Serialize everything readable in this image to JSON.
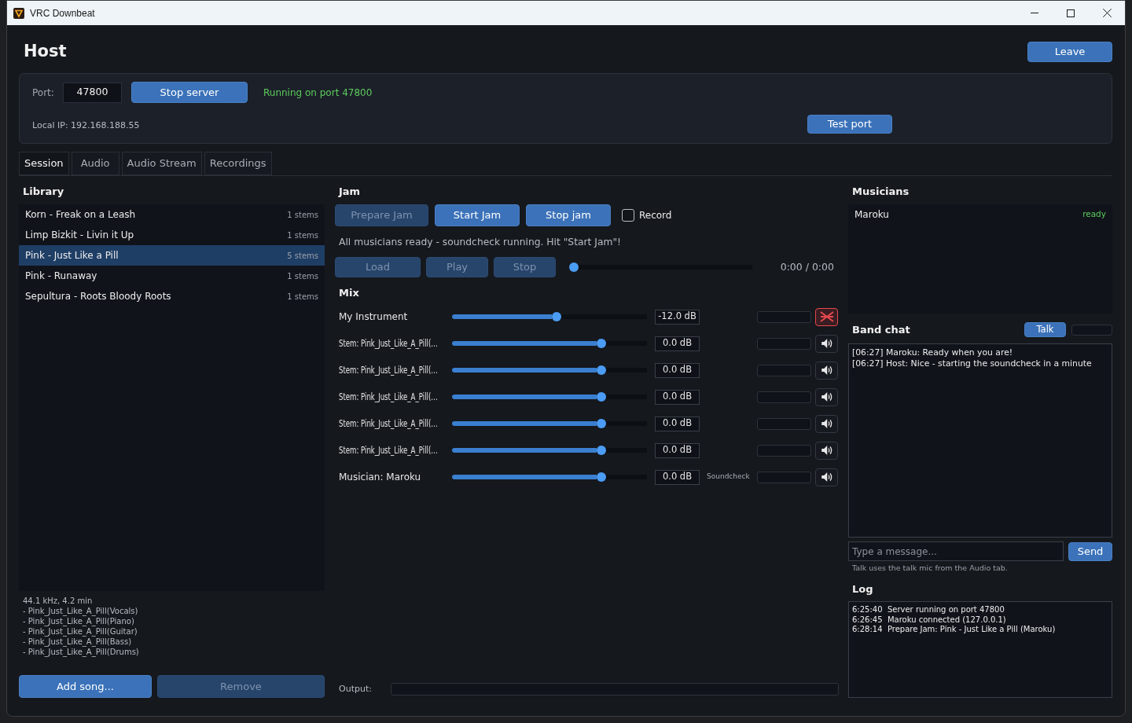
{
  "window": {
    "title": "VRC Downbeat"
  },
  "header": {
    "title": "Host",
    "leave_button": "Leave"
  },
  "server": {
    "port_label": "Port:",
    "port": "47800",
    "stop_button": "Stop server",
    "status": "Running on port 47800",
    "local_ip": "Local IP: 192.168.188.55",
    "test_button": "Test port"
  },
  "tabs": [
    {
      "label": "Session",
      "selected": true
    },
    {
      "label": "Audio",
      "selected": false
    },
    {
      "label": "Audio Stream",
      "selected": false
    },
    {
      "label": "Recordings",
      "selected": false
    }
  ],
  "library": {
    "title": "Library",
    "songs": [
      {
        "name": "Korn - Freak on a Leash",
        "stems": "1 stems",
        "selected": false
      },
      {
        "name": "Limp Bizkit - Livin it Up",
        "stems": "1 stems",
        "selected": false
      },
      {
        "name": "Pink - Just Like a Pill",
        "stems": "5 stems",
        "selected": true
      },
      {
        "name": "Pink - Runaway",
        "stems": "1 stems",
        "selected": false
      },
      {
        "name": "Sepultura - Roots Bloody Roots",
        "stems": "1 stems",
        "selected": false
      }
    ],
    "details": [
      "44.1 kHz, 4.2 min",
      "- Pink_Just_Like_A_Pill(Vocals)",
      "- Pink_Just_Like_A_Pill(Piano)",
      "- Pink_Just_Like_A_Pill(Guitar)",
      "- Pink_Just_Like_A_Pill(Bass)",
      "- Pink_Just_Like_A_Pill(Drums)"
    ],
    "buttons": [
      {
        "label": "Add song...",
        "disabled": false
      },
      {
        "label": "Remove",
        "disabled": true
      }
    ]
  },
  "jam": {
    "title": "Jam",
    "buttons": [
      {
        "label": "Prepare Jam",
        "disabled": true
      },
      {
        "label": "Start Jam",
        "disabled": false
      },
      {
        "label": "Stop jam",
        "disabled": false
      }
    ],
    "record": {
      "label": "Record",
      "checked": false
    },
    "status": "All musicians ready - soundcheck running. Hit \"Start Jam\"!",
    "transport": [
      {
        "label": "Load",
        "disabled": true
      },
      {
        "label": "Play",
        "disabled": true
      },
      {
        "label": "Stop",
        "disabled": true
      }
    ],
    "position": {
      "level": 0
    },
    "time": "0:00 / 0:00"
  },
  "mix": {
    "title": "Mix",
    "channels": [
      {
        "kind": "local",
        "name": "My Instrument",
        "level": 0.54,
        "value": "-12.0 dB",
        "muted": true
      },
      {
        "kind": "stem",
        "name": "Stem: Pink_Just_Like_A_Pill(…",
        "level": 0.78,
        "value": "0.0 dB",
        "muted": false
      },
      {
        "kind": "stem",
        "name": "Stem: Pink_Just_Like_A_Pill(…",
        "level": 0.78,
        "value": "0.0 dB",
        "muted": false
      },
      {
        "kind": "stem",
        "name": "Stem: Pink_Just_Like_A_Pill(…",
        "level": 0.78,
        "value": "0.0 dB",
        "muted": false
      },
      {
        "kind": "stem",
        "name": "Stem: Pink_Just_Like_A_Pill(…",
        "level": 0.78,
        "value": "0.0 dB",
        "muted": false
      },
      {
        "kind": "stem",
        "name": "Stem: Pink_Just_Like_A_Pill(…",
        "level": 0.78,
        "value": "0.0 dB",
        "muted": false
      },
      {
        "kind": "musician",
        "name": "Musician: Maroku",
        "level": 0.78,
        "value": "0.0 dB",
        "tag": "Soundcheck",
        "muted": false
      }
    ],
    "output_label": "Output:"
  },
  "musicians": {
    "title": "Musicians",
    "items": [
      {
        "name": "Maroku",
        "status": "ready"
      }
    ]
  },
  "chat": {
    "title": "Band chat",
    "talk_button": "Talk",
    "messages": [
      "[06:27] Maroku: Ready when you are!",
      "[06:27] Host: Nice - starting the soundcheck in a minute"
    ],
    "placeholder": "Type a message...",
    "send_button": "Send",
    "hint": "Talk uses the talk mic from the Audio tab."
  },
  "log": {
    "title": "Log",
    "lines": [
      "6:25:40  Server running on port 47800",
      "6:26:45  Maroku connected (127.0.0.1)",
      "6:28:14  Prepare Jam: Pink - Just Like a Pill (Maroku)"
    ]
  }
}
